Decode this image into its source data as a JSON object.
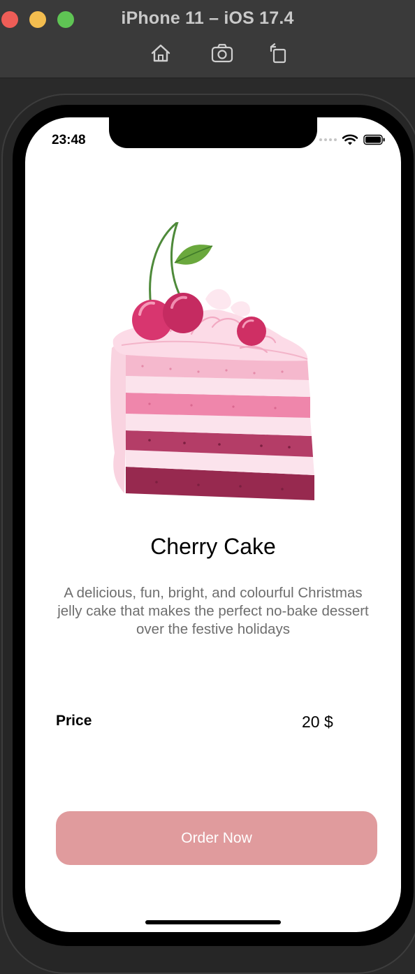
{
  "simulator": {
    "title": "iPhone 11 – iOS 17.4",
    "toolbar": [
      {
        "icon": "home-icon"
      },
      {
        "icon": "screenshot-icon"
      },
      {
        "icon": "rotate-icon"
      }
    ]
  },
  "status_bar": {
    "time": "23:48",
    "icons": [
      "signal-icon",
      "wifi-icon",
      "battery-icon"
    ]
  },
  "product": {
    "image_icon": "cherry-cake-illustration",
    "title": "Cherry Cake",
    "description": "A delicious, fun, bright, and colourful Christmas jelly cake that makes the perfect no-bake dessert over the festive holidays",
    "price_label": "Price",
    "price_value": "20 $"
  },
  "actions": {
    "order_label": "Order Now"
  },
  "colors": {
    "order_button_bg": "#e09b9d",
    "order_button_text": "#ffffff",
    "description_text": "#6e6e6e",
    "cake_light_pink": "#fbd7e4",
    "cake_mid_pink": "#ef8aae",
    "cake_dark": "#9c2f55",
    "cherry": "#d8366f",
    "leaf": "#6aa83d"
  }
}
